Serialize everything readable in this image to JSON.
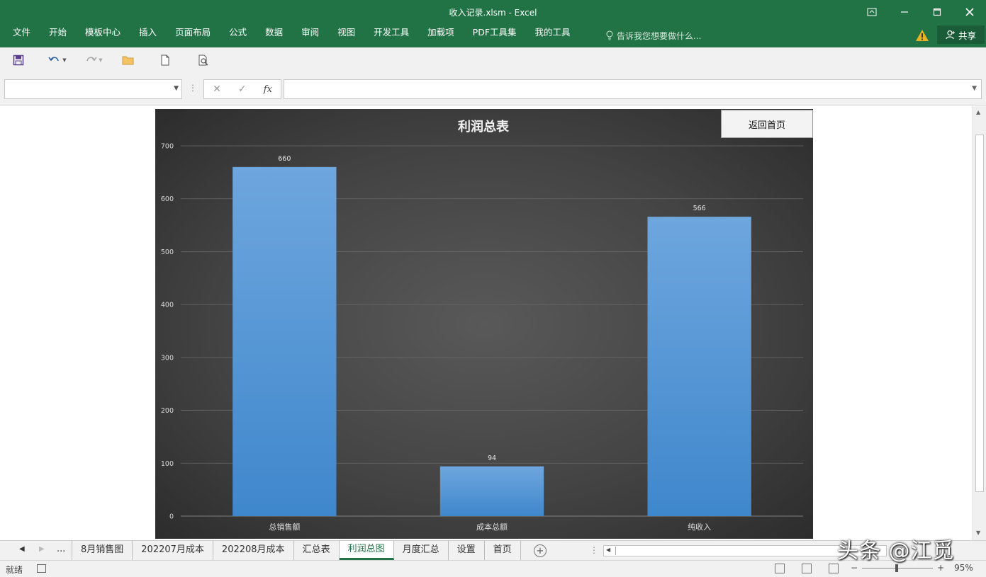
{
  "window": {
    "title": "收入记录.xlsm - Excel"
  },
  "ribbon": {
    "tabs": [
      "文件",
      "开始",
      "模板中心",
      "插入",
      "页面布局",
      "公式",
      "数据",
      "审阅",
      "视图",
      "开发工具",
      "加载项",
      "PDF工具集",
      "我的工具"
    ],
    "tell_me": "告诉我您想要做什么...",
    "share": "共享"
  },
  "formula_bar": {
    "fx": "fx",
    "name_box": "",
    "formula": ""
  },
  "chart_data": {
    "type": "bar",
    "title": "利润总表",
    "categories": [
      "总销售额",
      "成本总额",
      "纯收入"
    ],
    "values": [
      660,
      94,
      566
    ],
    "ylim": [
      0,
      700
    ],
    "yticks": [
      0,
      100,
      200,
      300,
      400,
      500,
      600,
      700
    ],
    "grid": true,
    "bar_color": "#5b9bd5",
    "background": "#404040"
  },
  "chart_button": {
    "label": "返回首页"
  },
  "sheet_tabs": {
    "ellipsis": "...",
    "tabs": [
      "8月销售图",
      "202207月成本",
      "202208月成本",
      "汇总表",
      "利润总图",
      "月度汇总",
      "设置",
      "首页"
    ],
    "active_index": 4
  },
  "status_bar": {
    "ready": "就绪",
    "zoom": "95%"
  },
  "watermark": "头条 @江觅",
  "colors": {
    "excel_green": "#217346"
  }
}
